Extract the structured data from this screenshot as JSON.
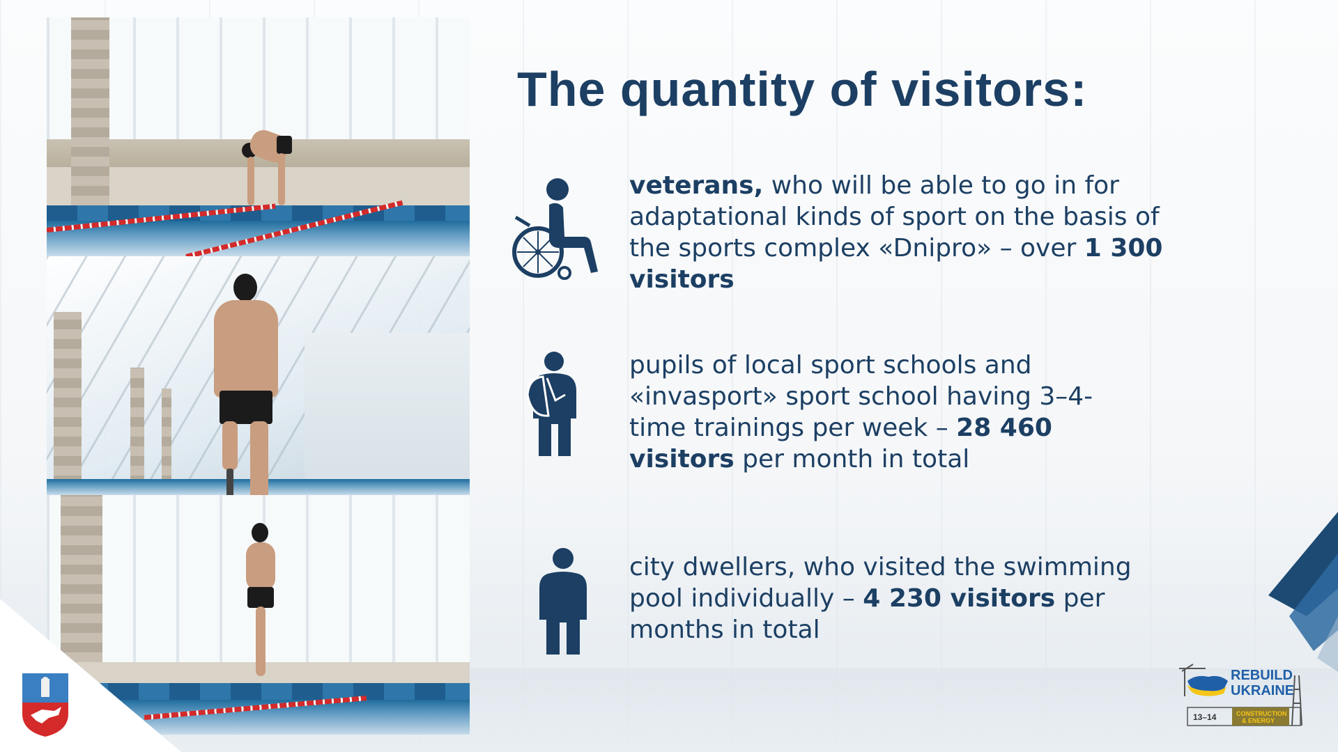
{
  "slide": {
    "title": "The quantity of visitors:",
    "items": [
      {
        "icon": "wheelchair-icon",
        "lines": [
          {
            "bold": "veterans,",
            "text": " who will be able to go in for"
          },
          {
            "text": "adaptational kinds of sport on the basis of"
          },
          {
            "text": "the sports complex «Dnipro» – over ",
            "bold": "1 300"
          },
          {
            "bold": "visitors"
          }
        ]
      },
      {
        "icon": "student-with-backpack-icon",
        "lines": [
          {
            "text": "pupils of local sport schools and"
          },
          {
            "text": "«invasport» sport school having 3–4-"
          },
          {
            "text": "time trainings per week – ",
            "bold": "28 460"
          },
          {
            "bold": "visitors",
            "text": " per month in total"
          }
        ]
      },
      {
        "icon": "person-icon",
        "lines": [
          {
            "text": "city dwellers, who visited the swimming"
          },
          {
            "text": "pool individually – ",
            "bold": "4 230 visitors",
            "text2": " per"
          },
          {
            "text": "months in total"
          }
        ]
      }
    ]
  },
  "logos": {
    "rebuild": {
      "line1": "REBUILD",
      "line2": "UKRAINE",
      "dates": "13–14",
      "tag1": "CONSTRUCTION",
      "tag2": "& ENERGY"
    }
  },
  "colors": {
    "primary": "#1c3f63",
    "accent_dark": "#1c4a73",
    "accent_light": "#2e6aa0",
    "ukraine_yellow": "#f5c518",
    "ukraine_blue": "#1f5fa8"
  }
}
